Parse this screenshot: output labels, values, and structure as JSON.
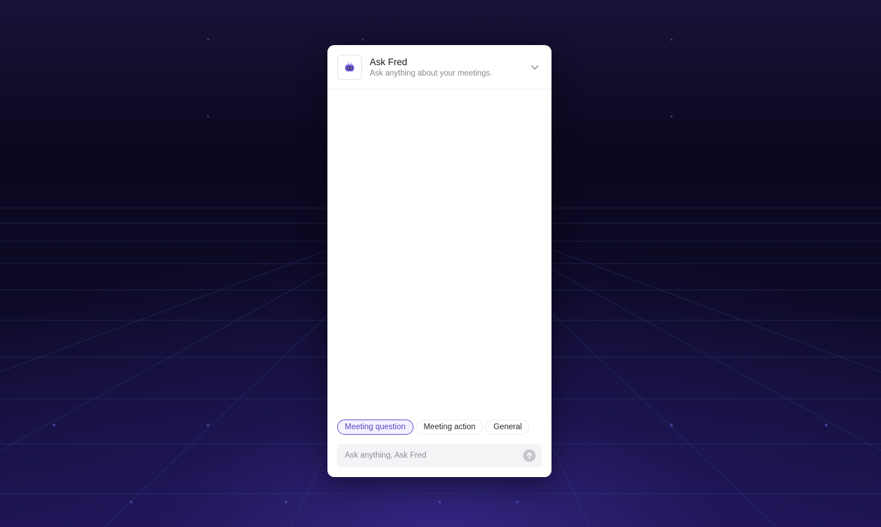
{
  "widget": {
    "title": "Ask Fred",
    "subtitle": "Ask anything about your meetings.",
    "avatar_icon": "robot-icon",
    "collapse_icon": "chevron-down-icon"
  },
  "chips": [
    {
      "label": "Meeting question",
      "active": true
    },
    {
      "label": "Meeting action",
      "active": false
    },
    {
      "label": "General",
      "active": false
    }
  ],
  "composer": {
    "placeholder": "Ask anything, Ask Fred",
    "value": "",
    "send_icon": "arrow-up-icon"
  },
  "colors": {
    "accent": "#6a52d6",
    "background": "#0c0820",
    "panel": "#fffffd"
  }
}
